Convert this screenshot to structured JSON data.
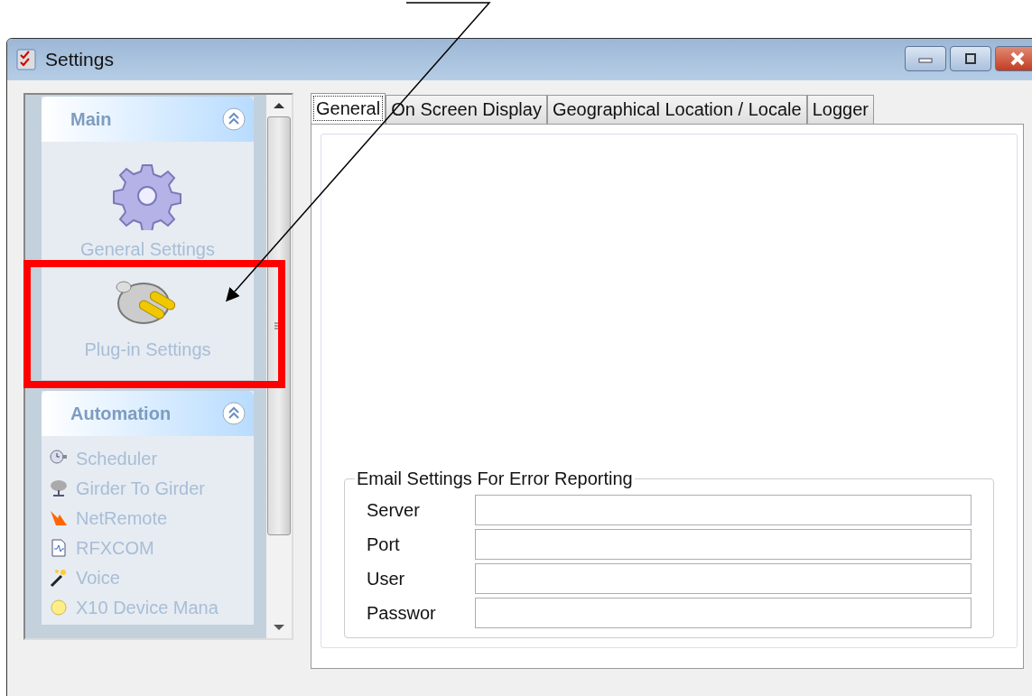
{
  "window": {
    "title": "Settings"
  },
  "sidebar": {
    "groups": [
      {
        "title": "Main",
        "kind": "large",
        "items": [
          {
            "label": "General Settings"
          },
          {
            "label": "Plug-in Settings"
          }
        ]
      },
      {
        "title": "Automation",
        "kind": "small",
        "items": [
          {
            "label": "Scheduler"
          },
          {
            "label": "Girder To Girder"
          },
          {
            "label": "NetRemote"
          },
          {
            "label": "RFXCOM"
          },
          {
            "label": "Voice"
          },
          {
            "label": "X10 Device Mana"
          }
        ]
      }
    ]
  },
  "tabs": [
    {
      "label": "General",
      "selected": true
    },
    {
      "label": "On Screen Display",
      "selected": false
    },
    {
      "label": "Geographical Location / Locale",
      "selected": false
    },
    {
      "label": "Logger",
      "selected": false
    }
  ],
  "email_group": {
    "title": "Email Settings For Error Reporting",
    "fields": [
      {
        "label": "Server"
      },
      {
        "label": "Port"
      },
      {
        "label": "User"
      },
      {
        "label": "Passwor"
      }
    ]
  }
}
